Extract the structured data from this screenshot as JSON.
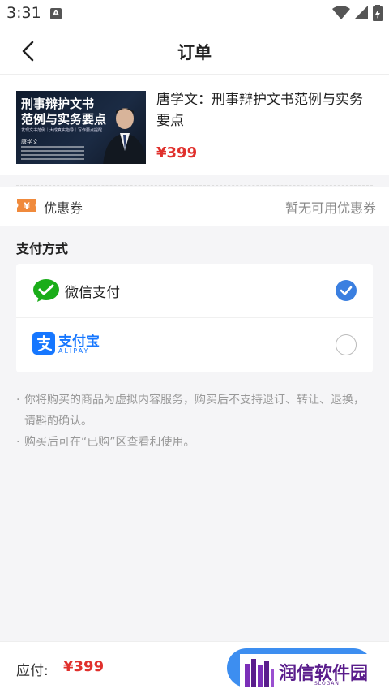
{
  "status_bar": {
    "time": "3:31",
    "notification_icon": "A"
  },
  "navbar": {
    "back_icon": "chevron-left-icon",
    "title": "订单"
  },
  "product": {
    "cover": {
      "title_line1": "刑事辩护文书",
      "title_line2": "范例与实务要点",
      "subtitle": "发现文书范例｜大成真实指导｜写作要点提醒",
      "author": "唐学文"
    },
    "title": "唐学文：刑事辩护文书范例与实务要点",
    "price": "¥399"
  },
  "coupon": {
    "icon": "coupon-ticket-icon",
    "label": "优惠券",
    "value": "暂无可用优惠券"
  },
  "payment": {
    "section_title": "支付方式",
    "methods": [
      {
        "name": "微信支付",
        "icon": "wechat-pay-icon",
        "selected": true
      },
      {
        "name": "支付宝",
        "sub": "ALIPAY",
        "icon": "alipay-icon",
        "selected": false
      }
    ]
  },
  "notes": [
    "你将购买的商品为虚拟内容服务，购买后不支持退订、转让、退换，请斟酌确认。",
    "购买后可在“已购”区查看和使用。"
  ],
  "bottom_bar": {
    "label": "应付:",
    "amount": "¥399"
  },
  "watermark": {
    "text": "润信软件园",
    "slogan": "SLOGAN"
  },
  "colors": {
    "price_red": "#e0302c",
    "accent_blue": "#3b7fe0",
    "wechat_green": "#1aad19",
    "alipay_blue": "#1677ff"
  }
}
